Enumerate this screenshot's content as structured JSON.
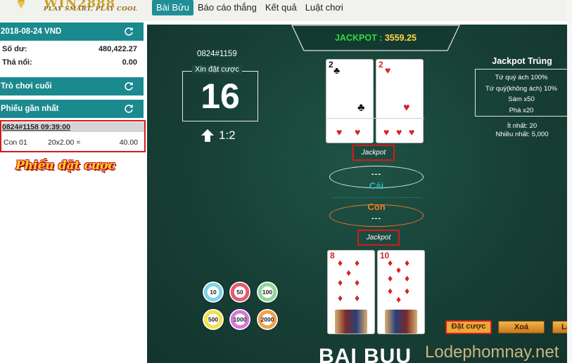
{
  "header": {
    "logo_text": "WIN2888",
    "slogan": "PLAY SMART, PLAY COOL",
    "nav": [
      {
        "label": "Bài Bửu",
        "active": true
      },
      {
        "label": "Báo cáo thắng",
        "active": false
      },
      {
        "label": "Kết quả",
        "active": false
      },
      {
        "label": "Luật chơi",
        "active": false
      }
    ]
  },
  "sidebar": {
    "date_header": "2018-08-24 VND",
    "balance_label": "Số dư:",
    "balance_value": "480,422.27",
    "float_label": "Thả nổi:",
    "float_value": "0.00",
    "last_game_header": "Trò chơi cuối",
    "recent_tickets_header": "Phiếu gần nhất",
    "ticket": {
      "id_time": "0824#1158 09:39:00",
      "side": "Con 01",
      "stake_formula": "20x2.00 =",
      "amount": "40.00"
    },
    "caption": "Phiếu đặt cược"
  },
  "game": {
    "jackpot_label": "JACKPOT : ",
    "jackpot_amount": "3559.25",
    "round_id": "0824#1159",
    "bet_prompt": "Xin đặt cược",
    "countdown": "16",
    "odds": "1:2",
    "cai_label": "Cái",
    "con_label": "Con",
    "cai_points": "---",
    "con_points": "---",
    "jackpot_badge": "Jackpot",
    "dealer_cards": [
      {
        "rank": "2",
        "suit": "♣",
        "color": "blk"
      },
      {
        "rank": "2",
        "suit": "♥",
        "color": "red"
      }
    ],
    "player_cards": [
      {
        "rank": "8",
        "suit": "♦",
        "color": "red"
      },
      {
        "rank": "10",
        "suit": "♦",
        "color": "red"
      }
    ],
    "jackpot_info": {
      "title": "Jackpot Trúng",
      "lines": [
        "Tứ quý ách 100%",
        "Tứ quý(không ách) 10%",
        "Sám x50",
        "Phá x20"
      ],
      "min_label": "Ít nhất: 20",
      "max_label": "Nhiều nhất: 5,000"
    },
    "chips": [
      {
        "value": "10",
        "color": "#7fd3e8"
      },
      {
        "value": "50",
        "color": "#e85a6a"
      },
      {
        "value": "100",
        "color": "#8fd69a"
      },
      {
        "value": "500",
        "color": "#f2e24a"
      },
      {
        "value": "1000",
        "color": "#d679d8"
      },
      {
        "value": "2000",
        "color": "#f2a24a"
      }
    ],
    "buttons": {
      "place_bet": "Đặt cược",
      "clear": "Xoá",
      "third": "Lặ"
    },
    "title": "BAI BUU"
  },
  "watermark": "Lodephomnay.net",
  "colors": {
    "teal": "#1b8a8e",
    "table": "#173f36",
    "highlight_red": "#d31b1b",
    "jackpot_green": "#2ddc3a",
    "jackpot_yellow": "#ffd642",
    "con_orange": "#f07a24",
    "cai_teal": "#2fb5b0"
  }
}
